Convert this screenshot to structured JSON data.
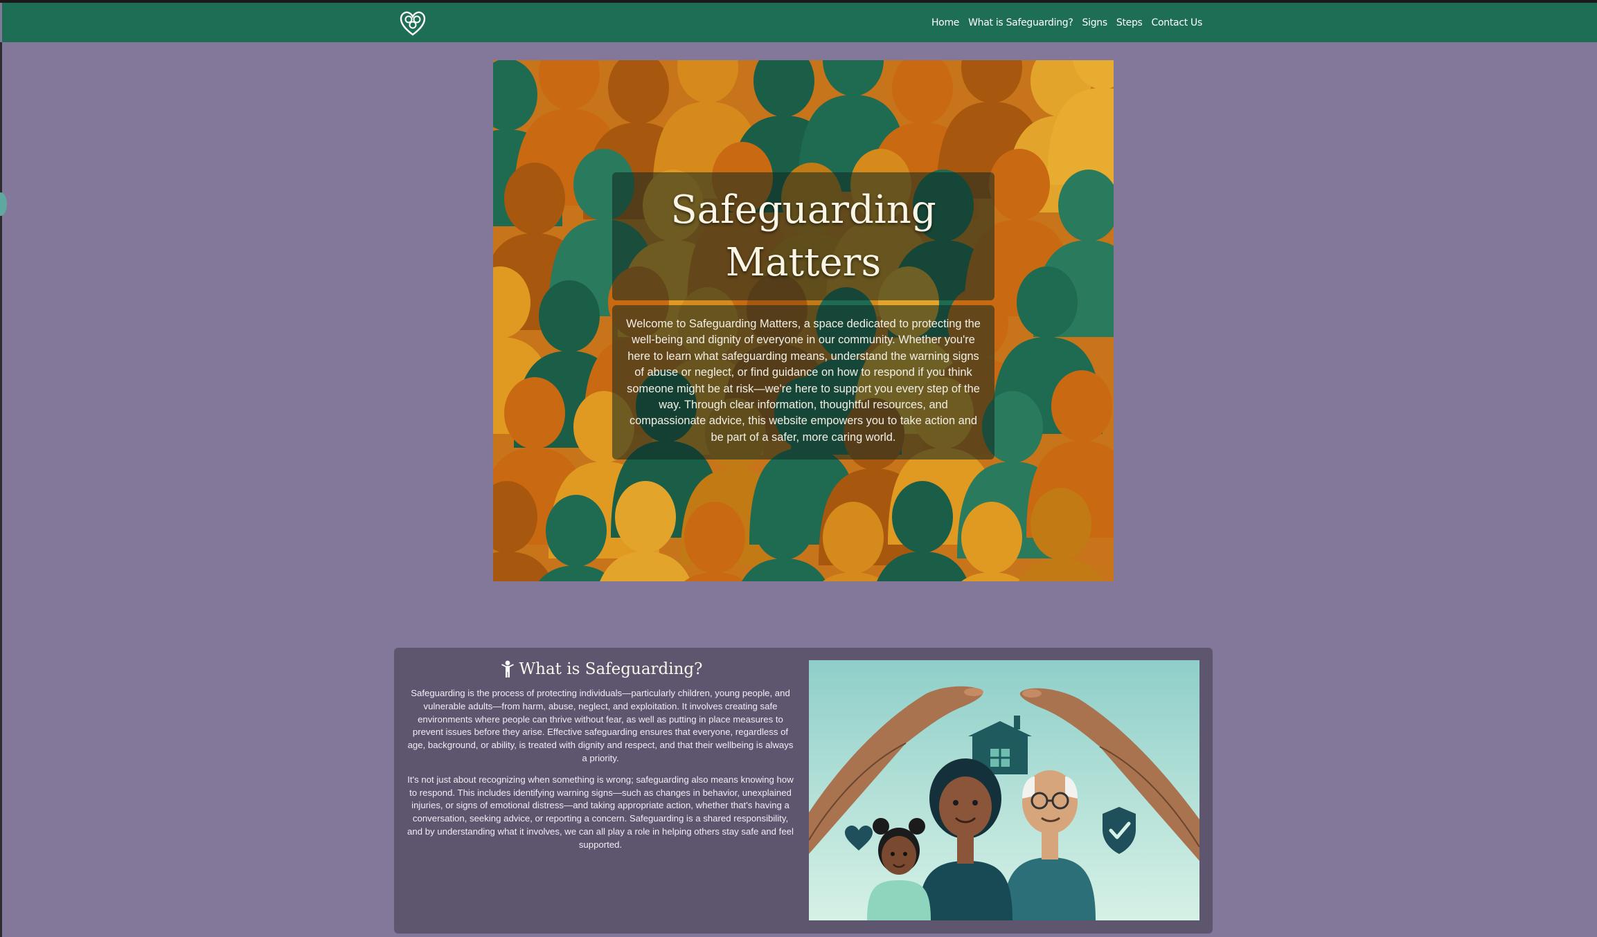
{
  "nav": {
    "logo_icon": "heart-knot-icon",
    "links": [
      "Home",
      "What is Safeguarding?",
      "Signs",
      "Steps",
      "Contact Us"
    ]
  },
  "hero": {
    "title": "Safeguarding Matters",
    "intro": "Welcome to Safeguarding Matters, a space dedicated to protecting the well-being and dignity of everyone in our community. Whether you're here to learn what safeguarding means, understand the warning signs of abuse or neglect, or find guidance on how to respond if you think someone might be at risk—we're here to support you every step of the way. Through clear information, thoughtful resources, and compassionate advice, this website empowers you to take action and be part of a safer, more caring world."
  },
  "what_is": {
    "icon": "person-icon",
    "heading": "What is Safeguarding?",
    "paragraphs": [
      "Safeguarding is the process of protecting individuals—particularly children, young people, and vulnerable adults—from harm, abuse, neglect, and exploitation. It involves creating safe environments where people can thrive without fear, as well as putting in place measures to prevent issues before they arise. Effective safeguarding ensures that everyone, regardless of age, background, or ability, is treated with dignity and respect, and that their wellbeing is always a priority.",
      "It's not just about recognizing when something is wrong; safeguarding also means knowing how to respond. This includes identifying warning signs—such as changes in behavior, unexplained injuries, or signs of emotional distress—and taking appropriate action, whether that's having a conversation, seeking advice, or reporting a concern. Safeguarding is a shared responsibility, and by understanding what it involves, we can all play a role in helping others stay safe and feel supported."
    ]
  },
  "colors": {
    "nav": "#1e6e55",
    "page_bg": "#837899",
    "card_bg": "#5e556f"
  }
}
